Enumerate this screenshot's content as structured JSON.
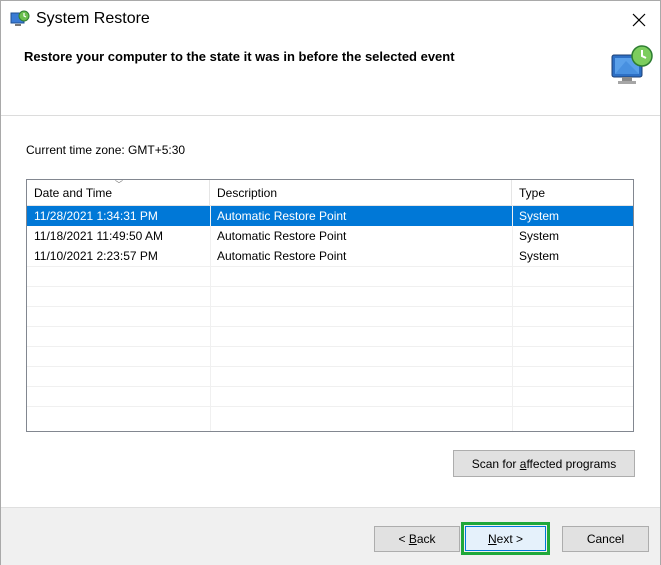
{
  "window": {
    "title": "System Restore",
    "icon": "system-restore-icon"
  },
  "header": {
    "text": "Restore your computer to the state it was in before the selected event",
    "icon": "monitor-restore-icon"
  },
  "timezone_label": "Current time zone: GMT+5:30",
  "table": {
    "columns": [
      "Date and Time",
      "Description",
      "Type"
    ],
    "sort_column": "Date and Time",
    "rows": [
      {
        "date": "11/28/2021 1:34:31 PM",
        "description": "Automatic Restore Point",
        "type": "System",
        "selected": true
      },
      {
        "date": "11/18/2021 11:49:50 AM",
        "description": "Automatic Restore Point",
        "type": "System",
        "selected": false
      },
      {
        "date": "11/10/2021 2:23:57 PM",
        "description": "Automatic Restore Point",
        "type": "System",
        "selected": false
      }
    ]
  },
  "buttons": {
    "scan_pre": "Scan for ",
    "scan_u": "a",
    "scan_post": "ffected programs",
    "back_pre": "< ",
    "back_u": "B",
    "back_post": "ack",
    "next_u": "N",
    "next_post": "ext >",
    "cancel": "Cancel"
  },
  "colors": {
    "selection": "#0078d7",
    "highlight_border": "#1fa83a"
  }
}
